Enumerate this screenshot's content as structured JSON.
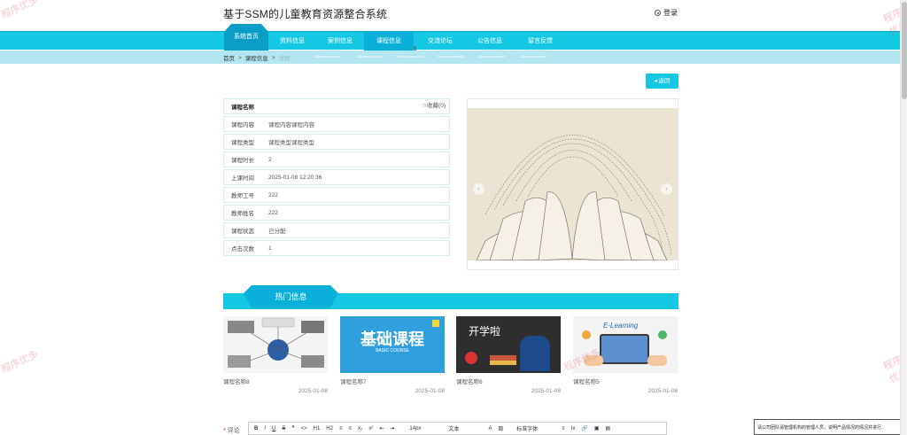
{
  "header": {
    "title": "基于SSM的儿童教育资源整合系统",
    "login": "登录"
  },
  "nav": {
    "items": [
      {
        "label": "系统首页"
      },
      {
        "label": "资料信息"
      },
      {
        "label": "案例信息"
      },
      {
        "label": "课程信息"
      },
      {
        "label": "交流论坛"
      },
      {
        "label": "公告信息"
      },
      {
        "label": "留言反馈"
      }
    ]
  },
  "breadcrumb": {
    "home": "首页",
    "sep": ">",
    "section": "课程信息",
    "current": "详情"
  },
  "back": {
    "label": "返回"
  },
  "detail": {
    "name_label": "课程名称",
    "favorite": "收藏(0)",
    "rows": [
      {
        "k": "课程内容",
        "v": "课程内容课程内容"
      },
      {
        "k": "课程类型",
        "v": "课程类型课程类型"
      },
      {
        "k": "课程时长",
        "v": "2"
      },
      {
        "k": "上课时间",
        "v": "2025-01-08 12:20:36"
      },
      {
        "k": "教师工号",
        "v": "222"
      },
      {
        "k": "教师姓名",
        "v": "222"
      },
      {
        "k": "课程状态",
        "v": "已分配"
      },
      {
        "k": "点击次数",
        "v": "1"
      }
    ]
  },
  "hot": {
    "title": "热门信息",
    "cards": [
      {
        "name": "课程名称8",
        "date": "2025-01-08"
      },
      {
        "name": "课程名称7",
        "date": "2025-01-08",
        "image_text": "基础课程",
        "image_sub": "BASIC COURSE"
      },
      {
        "name": "课程名称6",
        "date": "2025-01-08",
        "image_text": "开学啦"
      },
      {
        "name": "课程名称5",
        "date": "2025-01-08",
        "image_text": "E-Learning"
      }
    ]
  },
  "comment": {
    "label": "评论",
    "toolbar": [
      "B",
      "I",
      "U",
      "S",
      "❞",
      "<>",
      "H1",
      "H2",
      "≡",
      "≡",
      "x₂",
      "x²",
      "⇤",
      "⇥",
      "14px",
      "文本",
      "A",
      "▨",
      "标准字体",
      "≡",
      "Ix",
      "🔗",
      "▣",
      "▤"
    ]
  },
  "notice": "请公司团队请管理机构的管理人员，说明产品情况的情况并进行..",
  "watermark": "程序优多",
  "colors": {
    "accent": "#14c8e4",
    "accent_dark": "#0a9ec6",
    "crumb_bg": "#b3e6f0"
  }
}
